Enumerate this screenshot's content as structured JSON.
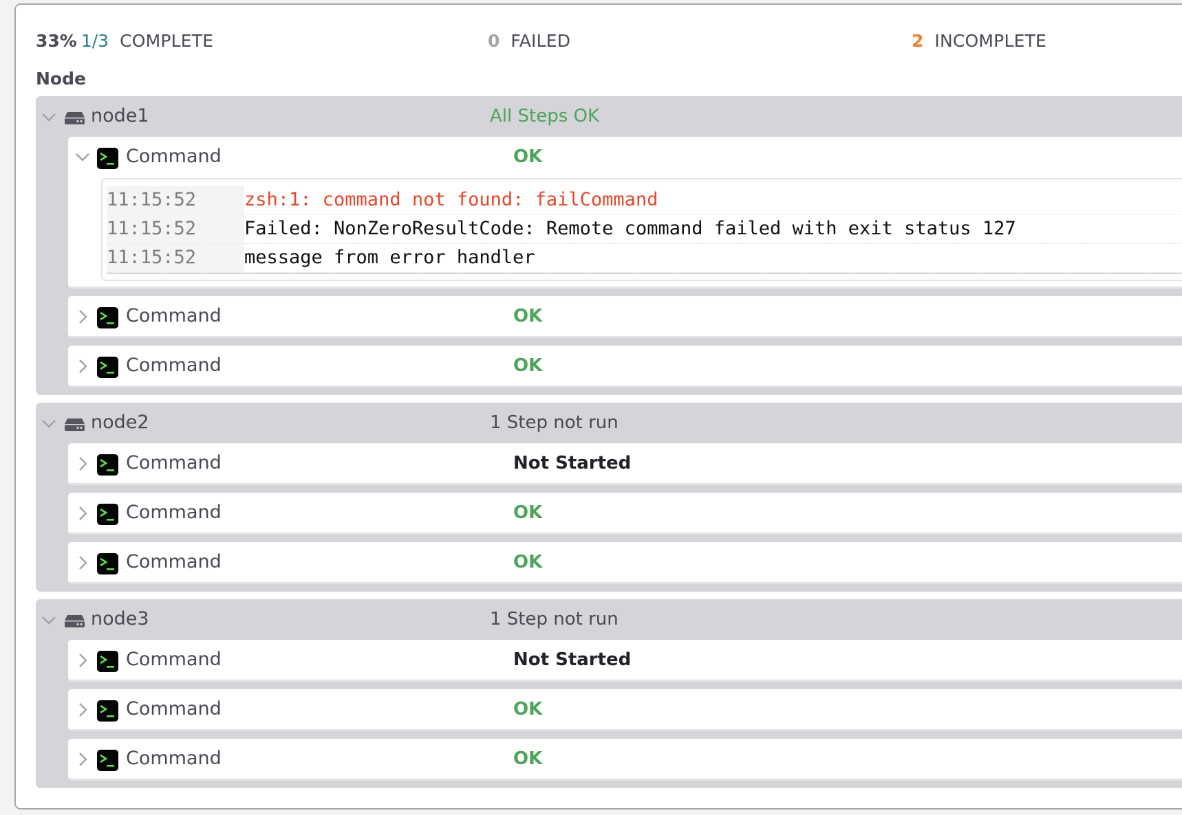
{
  "summary": {
    "percent": "33%",
    "fraction": "1/3",
    "complete_label": "COMPLETE",
    "failed_count": "0",
    "failed_label": "FAILED",
    "incomplete_count": "2",
    "incomplete_label": "INCOMPLETE"
  },
  "node_heading": "Node",
  "colors": {
    "ok": "#4ea45a",
    "error": "#e8472a",
    "fraction": "#2e7d8c",
    "incomplete": "#ee7f2e",
    "group_bg": "#d4d4d9"
  },
  "groups": [
    {
      "name": "node1",
      "status": "All Steps OK",
      "status_kind": "ok",
      "expanded": true,
      "steps": [
        {
          "name": "Command",
          "status": "OK",
          "expanded": true,
          "log": [
            {
              "time": "11:15:52",
              "message": "zsh:1: command not found: failCommand",
              "level": "error"
            },
            {
              "time": "11:15:52",
              "message": "Failed: NonZeroResultCode: Remote command failed with exit status 127",
              "level": "normal"
            },
            {
              "time": "11:15:52",
              "message": "message from error handler",
              "level": "normal"
            }
          ]
        },
        {
          "name": "Command",
          "status": "OK",
          "expanded": false
        },
        {
          "name": "Command",
          "status": "OK",
          "expanded": false
        }
      ]
    },
    {
      "name": "node2",
      "status": "1 Step not run",
      "status_kind": "neutral",
      "expanded": true,
      "steps": [
        {
          "name": "Command",
          "status": "Not Started",
          "expanded": false
        },
        {
          "name": "Command",
          "status": "OK",
          "expanded": false
        },
        {
          "name": "Command",
          "status": "OK",
          "expanded": false
        }
      ]
    },
    {
      "name": "node3",
      "status": "1 Step not run",
      "status_kind": "neutral",
      "expanded": true,
      "steps": [
        {
          "name": "Command",
          "status": "Not Started",
          "expanded": false
        },
        {
          "name": "Command",
          "status": "OK",
          "expanded": false
        },
        {
          "name": "Command",
          "status": "OK",
          "expanded": false
        }
      ]
    }
  ]
}
